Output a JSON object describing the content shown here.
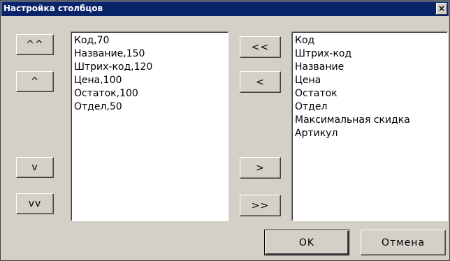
{
  "window": {
    "title": "Настройка столбцов",
    "close_label": "×"
  },
  "order_buttons": {
    "top": "^^",
    "up": "^",
    "down": "v",
    "bottom": "vv"
  },
  "transfer_buttons": {
    "add_all": "<<",
    "add": "<",
    "remove": ">",
    "remove_all": ">>"
  },
  "selected_columns": [
    "Код,70",
    "Название,150",
    "Штрих-код,120",
    "Цена,100",
    "Остаток,100",
    "Отдел,50"
  ],
  "available_columns": [
    "Код",
    "Штрих-код",
    "Название",
    "Цена",
    "Остаток",
    "Отдел",
    "Максимальная скидка",
    "Артикул"
  ],
  "footer": {
    "ok_label": "OK",
    "cancel_label": "Отмена"
  }
}
